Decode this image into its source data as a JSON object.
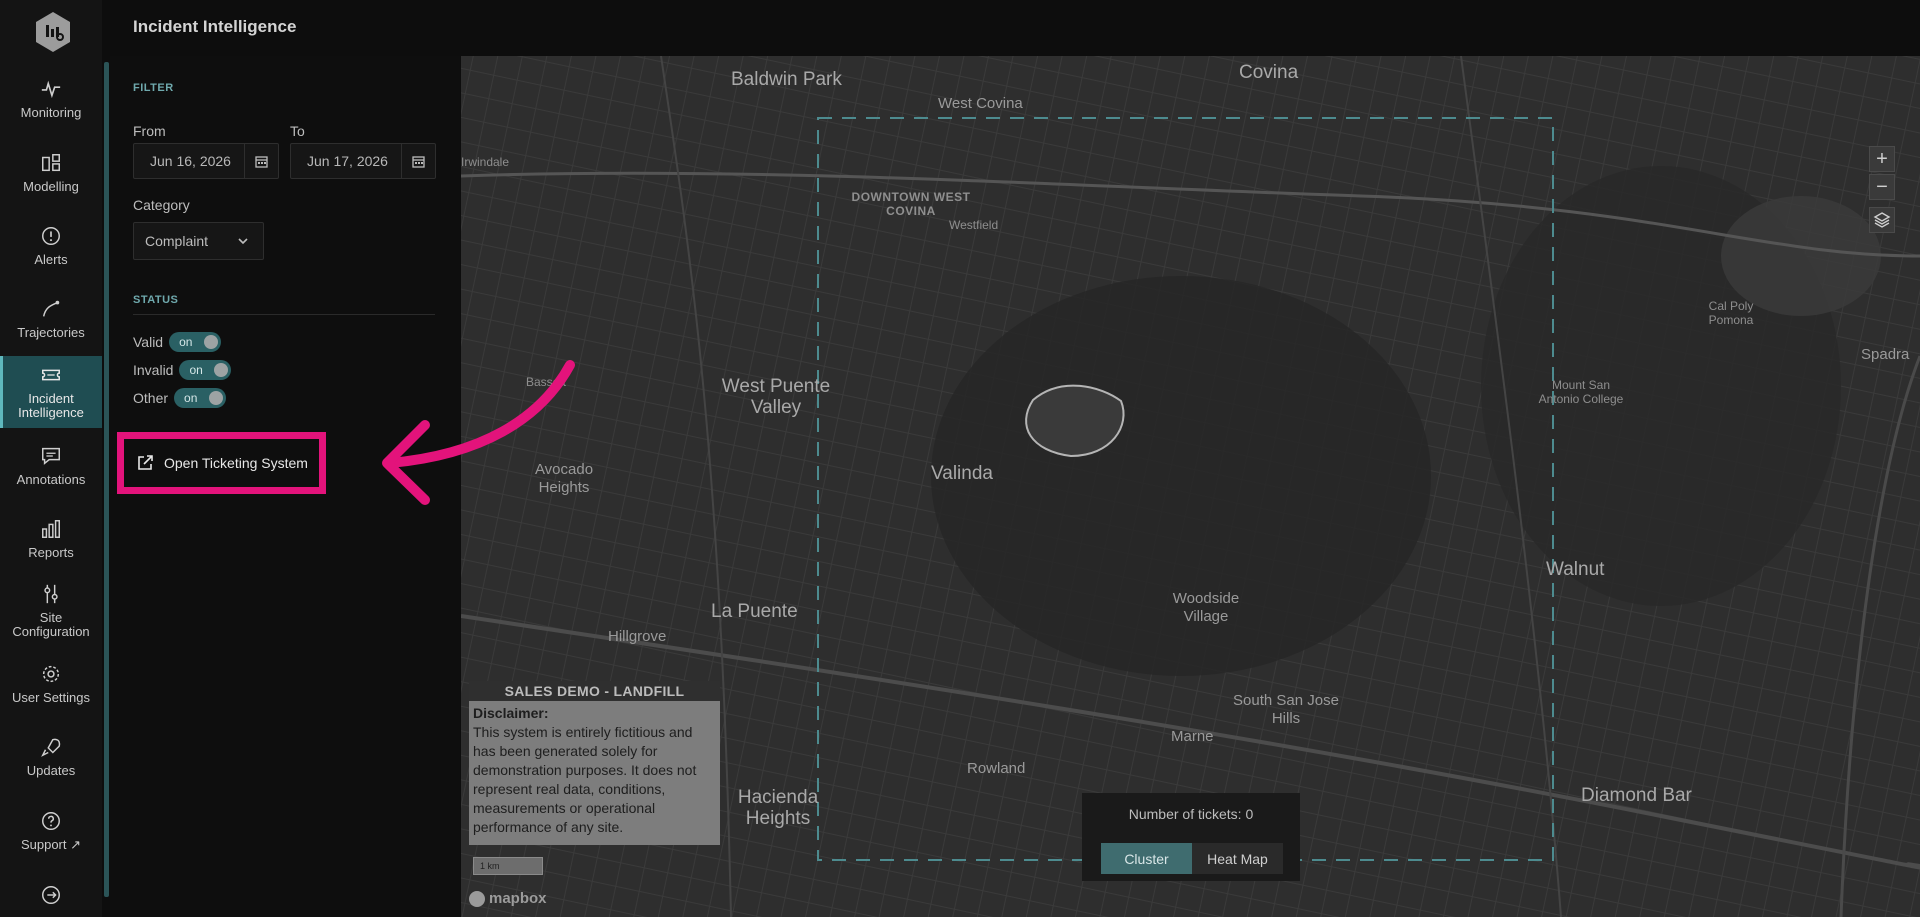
{
  "app": {
    "title": "Incident Intelligence"
  },
  "nav": {
    "items": [
      {
        "label": "Monitoring",
        "icon": "monitoring-icon"
      },
      {
        "label": "Modelling",
        "icon": "modelling-icon"
      },
      {
        "label": "Alerts",
        "icon": "alert-icon"
      },
      {
        "label": "Trajectories",
        "icon": "trajectory-icon"
      },
      {
        "label": "Incident Intelligence",
        "icon": "ticket-icon",
        "active": true
      },
      {
        "label": "Annotations",
        "icon": "comment-icon"
      },
      {
        "label": "Reports",
        "icon": "bar-chart-icon"
      },
      {
        "label": "Site Configuration",
        "icon": "sliders-icon"
      },
      {
        "label": "User Settings",
        "icon": "gear-icon"
      },
      {
        "label": "Updates",
        "icon": "rocket-icon"
      },
      {
        "label": "Support",
        "icon": "help-icon"
      }
    ]
  },
  "filter": {
    "section_label": "FILTER",
    "from_label": "From",
    "from_value": "Jun 16, 2026",
    "to_label": "To",
    "to_value": "Jun 17, 2026",
    "category_label": "Category",
    "category_value": "Complaint"
  },
  "status": {
    "section_label": "STATUS",
    "toggles": [
      {
        "label": "Valid",
        "state": "on"
      },
      {
        "label": "Invalid",
        "state": "on"
      },
      {
        "label": "Other",
        "state": "on"
      }
    ]
  },
  "ticketing": {
    "label": "Open Ticketing System"
  },
  "map": {
    "places": [
      "Baldwin Park",
      "Covina",
      "West Covina",
      "DOWNTOWN WEST COVINA",
      "Westfield",
      "West Puente Valley",
      "Valinda",
      "Avocado Heights",
      "La Puente",
      "Hillgrove",
      "Woodside Village",
      "Walnut",
      "Mount San Antonio College",
      "Cal Poly Pomona",
      "Spadra",
      "South San Jose Hills",
      "Marne",
      "Rowland",
      "Hacienda Heights",
      "Diamond Bar",
      "Bassett",
      "Irwindale"
    ],
    "zoom_in": "+",
    "zoom_out": "−",
    "scale": "1 km",
    "attribution": "mapbox"
  },
  "disclaimer": {
    "header": "SALES DEMO - LANDFILL",
    "title": "Disclaimer:",
    "body": "This system is entirely fictitious and has been generated solely for demonstration purposes. It does not represent real data, conditions, measurements or operational performance of any site."
  },
  "tickets": {
    "count_text": "Number of tickets: 0",
    "tab_cluster": "Cluster",
    "tab_heatmap": "Heat Map"
  },
  "colors": {
    "accent": "#5fb8bd",
    "highlight": "#e3137b",
    "active_nav": "#1f4d52"
  }
}
